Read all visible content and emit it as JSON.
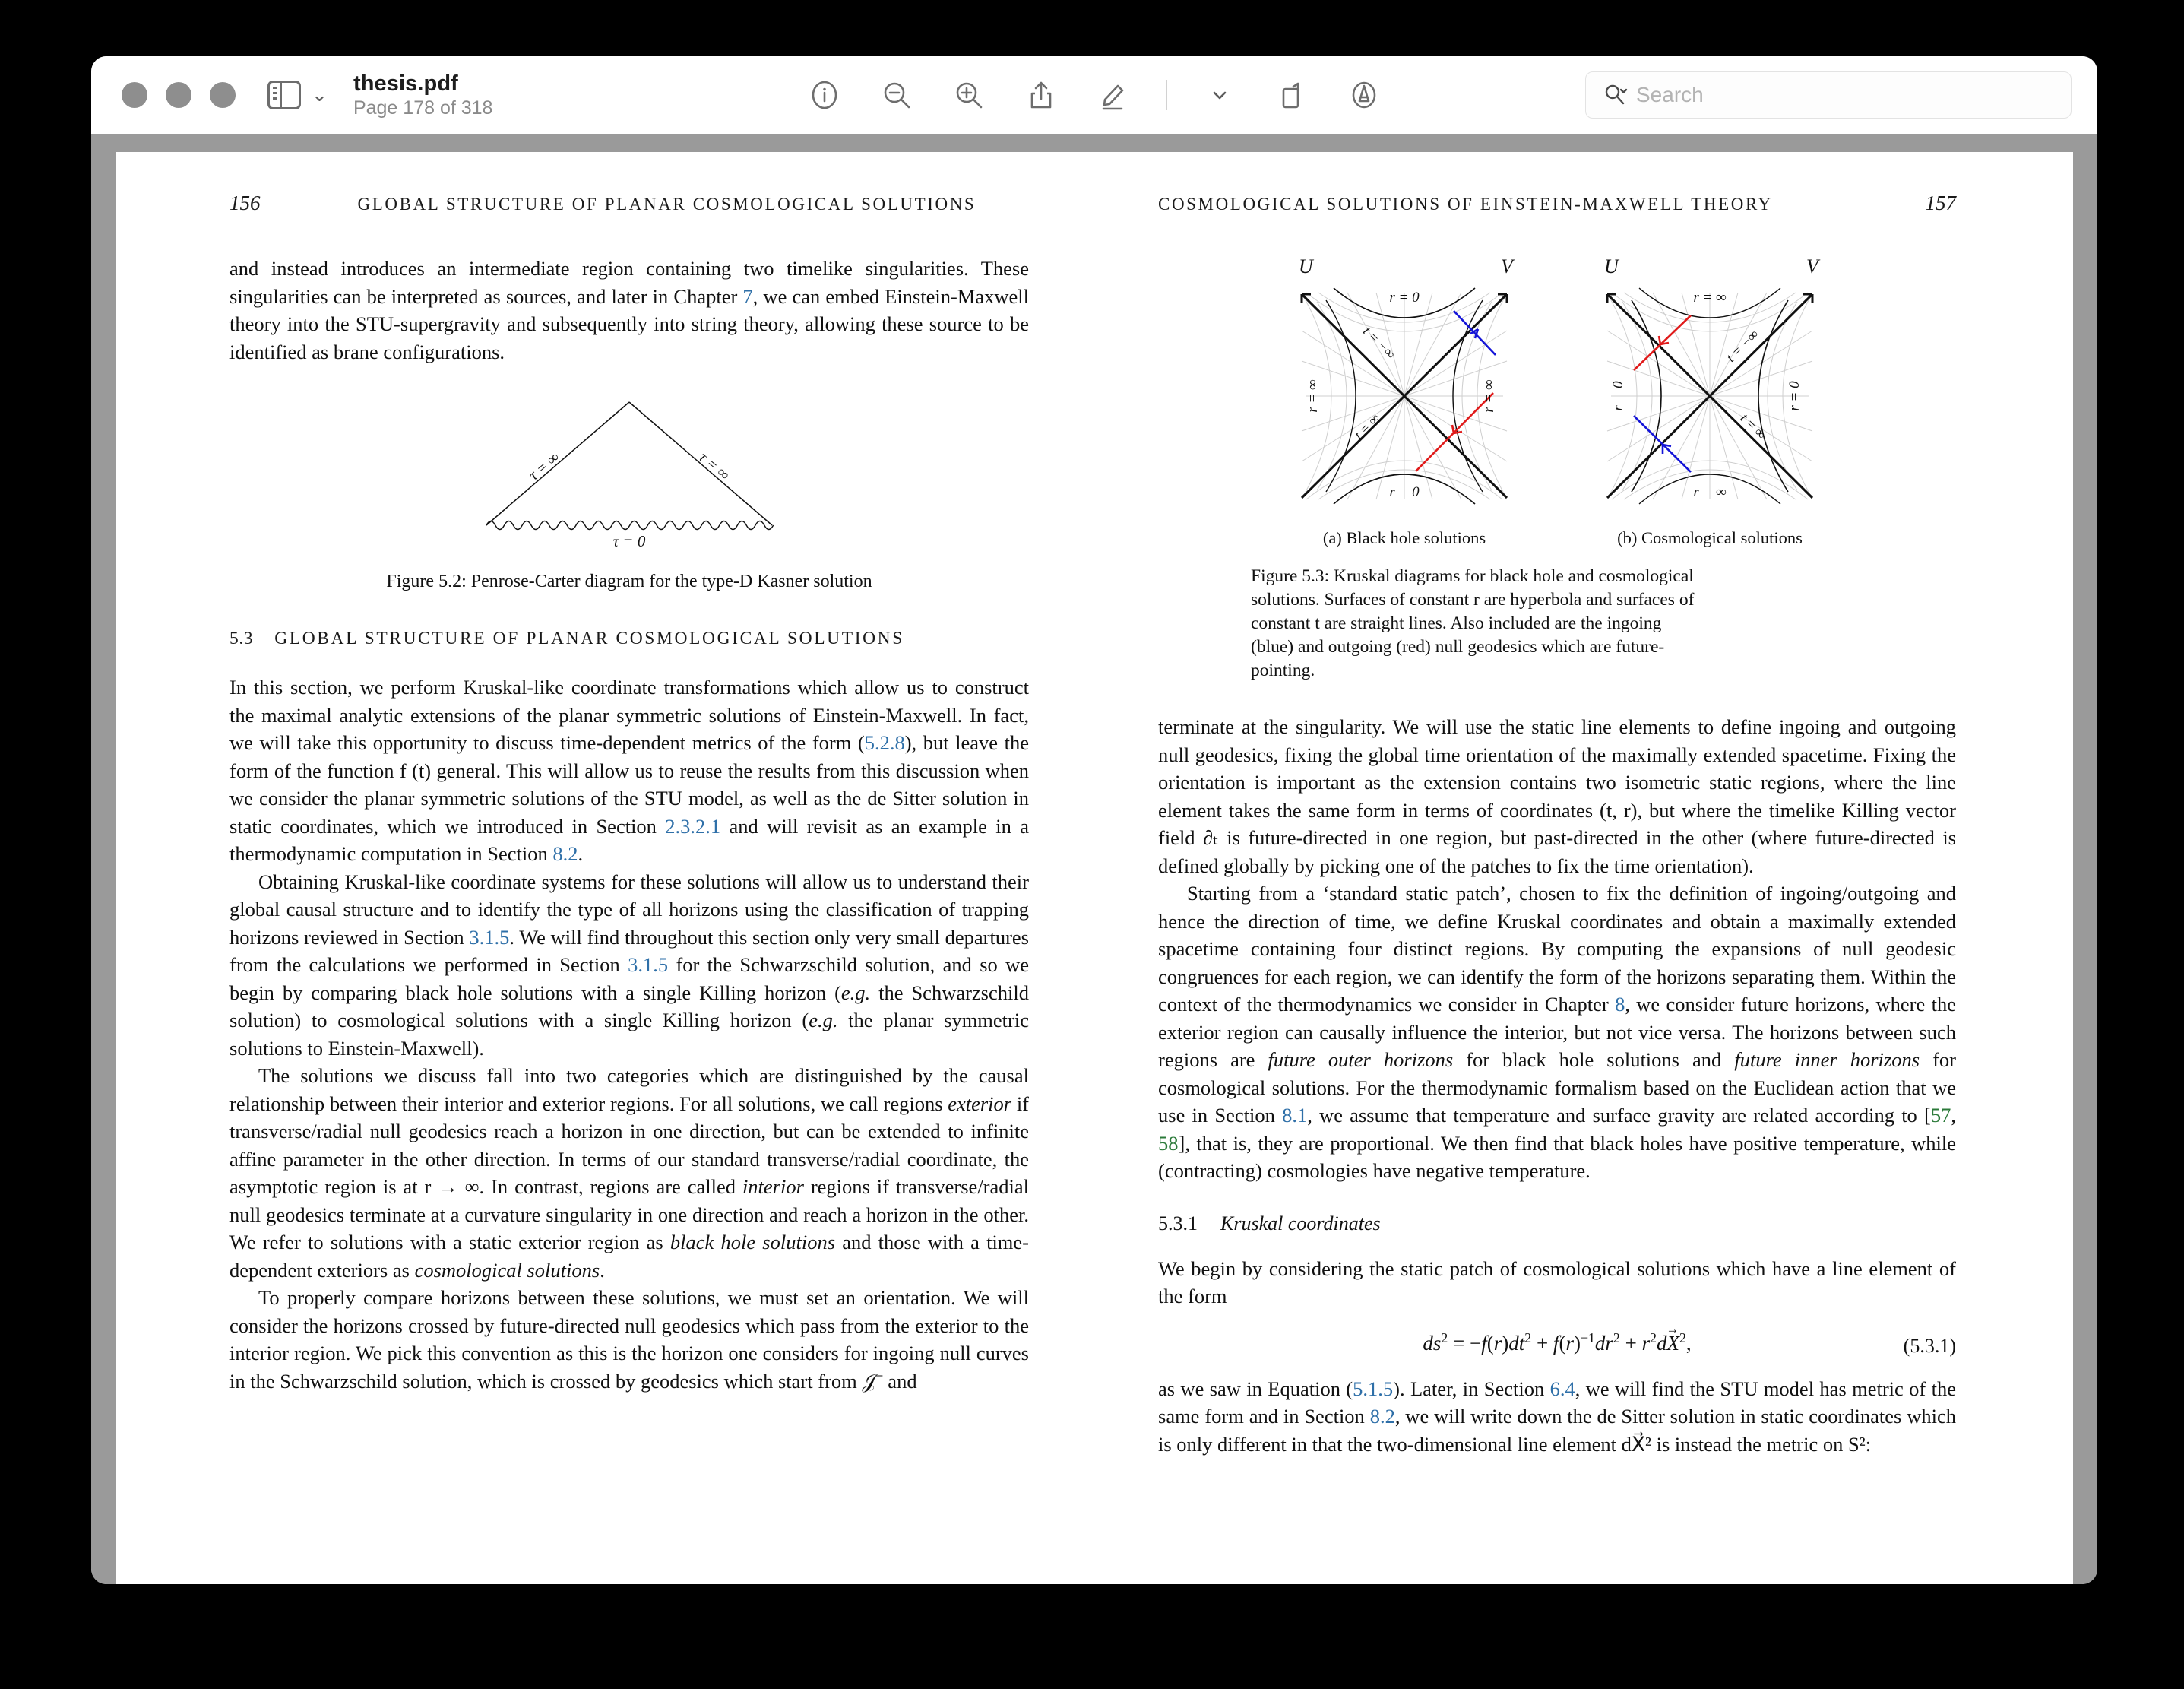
{
  "window": {
    "title": "thesis.pdf",
    "page_indicator": "Page 178 of 318",
    "traffic_lights": [
      "close-button",
      "minimize-button",
      "maximize-button"
    ]
  },
  "toolbar": {
    "sidebar_toggle": "sidebar-toggle-icon",
    "sidebar_chevron": "⌄",
    "buttons": [
      {
        "name": "info-button",
        "icon": "info-circle-icon"
      },
      {
        "name": "zoom-out-button",
        "icon": "magnifier-minus-icon"
      },
      {
        "name": "zoom-in-button",
        "icon": "magnifier-plus-icon"
      },
      {
        "name": "share-button",
        "icon": "share-arrow-up-icon"
      },
      {
        "name": "markup-button",
        "icon": "highlighter-pen-icon"
      },
      {
        "name": "markup-options-button",
        "icon": "chevron-down-icon"
      },
      {
        "name": "rotate-button",
        "icon": "rotate-page-icon"
      },
      {
        "name": "annotate-button",
        "icon": "circled-a-pen-icon"
      }
    ],
    "search": {
      "placeholder": "Search",
      "icon": "search-magnifier-chevron-icon",
      "value": ""
    }
  },
  "document": {
    "left_page": {
      "folio": "156",
      "running_head": "GLOBAL STRUCTURE OF PLANAR COSMOLOGICAL SOLUTIONS",
      "para_1_a": "and instead introduces an intermediate region containing two timelike singularities. These singularities can be interpreted as sources, and later in Chapter ",
      "para_1_ref": "7",
      "para_1_b": ", we can embed Einstein-Maxwell theory into the STU-supergravity and subsequently into string theory, allowing these source to be identified as brane configurations.",
      "figure_5_2": {
        "caption": "Figure 5.2: Penrose-Carter diagram for the type-D Kasner solution",
        "label_left": "τ = ∞",
        "label_right": "τ = ∞",
        "label_bottom": "τ = 0"
      },
      "section": {
        "number": "5.3",
        "title": "GLOBAL STRUCTURE OF PLANAR COSMOLOGICAL SOLUTIONS"
      },
      "para_2_a": "In this section, we perform Kruskal-like coordinate transformations which allow us to construct the maximal analytic extensions of the planar symmetric solutions of Einstein-Maxwell. In fact, we will take this opportunity to discuss time-dependent metrics of the form (",
      "para_2_ref1": "5.2.8",
      "para_2_b": "), but leave the form of the function f (t) general. This will allow us to reuse the results from this discussion when we consider the planar symmetric solutions of the STU model, as well as the de Sitter solution in static coordinates, which we introduced in Section ",
      "para_2_ref2": "2.3.2.1",
      "para_2_c": " and will revisit as an example in a thermodynamic computation in Section ",
      "para_2_ref3": "8.2",
      "para_2_d": ".",
      "para_3_a": "Obtaining Kruskal-like coordinate systems for these solutions will allow us to understand their global causal structure and to identify the type of all horizons using the classification of trapping horizons reviewed in Section ",
      "para_3_ref1": "3.1.5",
      "para_3_b": ". We will find throughout this section only very small departures from the calculations we performed in Section ",
      "para_3_ref2": "3.1.5",
      "para_3_c": " for the Schwarzschild solution, and so we begin by comparing black hole solutions with a single Killing horizon (",
      "para_3_em1": "e.g.",
      "para_3_d": " the Schwarzschild solution) to cosmological solutions with a single Killing horizon (",
      "para_3_em2": "e.g.",
      "para_3_e": " the planar symmetric solutions to Einstein-Maxwell).",
      "para_4_a": "The solutions we discuss fall into two categories which are distinguished by the causal relationship between their interior and exterior regions. For all solutions, we call regions ",
      "para_4_em1": "exterior",
      "para_4_b": " if transverse/radial null geodesics reach a horizon in one direction, but can be extended to infinite affine parameter in the other direction. In terms of our standard transverse/radial coordinate, the asymptotic region is at r → ∞. In contrast, regions are called ",
      "para_4_em2": "interior",
      "para_4_c": " regions if transverse/radial null geodesics terminate at a curvature singularity in one direction and reach a horizon in the other. We refer to solutions with a static exterior region as ",
      "para_4_em3": "black hole solutions",
      "para_4_d": " and those with a time-dependent exteriors as ",
      "para_4_em4": "cosmological solutions",
      "para_4_e": ".",
      "para_5": "To properly compare horizons between these solutions, we must set an orientation. We will consider the horizons crossed by future-directed null geodesics which pass from the exterior to the interior region. We pick this convention as this is the horizon one considers for ingoing null curves in the Schwarzschild solution, which is crossed by geodesics which start from 𝒥⁻ and"
    },
    "right_page": {
      "running_head": "COSMOLOGICAL SOLUTIONS OF EINSTEIN-MAXWELL THEORY",
      "folio": "157",
      "figure_5_3": {
        "axis_u": "U",
        "axis_v": "V",
        "panel_a": {
          "subcaption": "(a) Black hole solutions",
          "top": "r = 0",
          "bottom": "r = 0",
          "left": "r = ∞",
          "right": "r = ∞",
          "diag_upper": "t = −∞",
          "diag_lower": "t = ∞"
        },
        "panel_b": {
          "subcaption": "(b) Cosmological solutions",
          "top": "r = ∞",
          "bottom": "r = ∞",
          "left": "r = 0",
          "right": "r = 0",
          "diag_upper": "t = −∞",
          "diag_lower": "t = ∞"
        },
        "caption": "Figure 5.3: Kruskal diagrams for black hole and cosmological solutions. Surfaces of constant r are hyperbola and surfaces of constant t are straight lines. Also included are the ingoing (blue) and outgoing (red) null geodesics which are future-pointing.",
        "colors": {
          "ingoing": "#1414d8",
          "outgoing": "#e01a1a",
          "grid": "#cfcfcf",
          "axis": "#111111"
        }
      },
      "para_1": "terminate at the singularity. We will use the static line elements to define ingoing and outgoing null geodesics, fixing the global time orientation of the maximally extended spacetime. Fixing the orientation is important as the extension contains two isometric static regions, where the line element takes the same form in terms of coordinates (t, r), but where the timelike Killing vector field ∂ₜ is future-directed in one region, but past-directed in the other (where future-directed is defined globally by picking one of the patches to fix the time orientation).",
      "para_2_a": "Starting from a ‘standard static patch’, chosen to fix the definition of ingoing/outgoing and hence the direction of time, we define Kruskal coordinates and obtain a maximally extended spacetime containing four distinct regions. By computing the expansions of null geodesic congruences for each region, we can identify the form of the horizons separating them. Within the context of the thermodynamics we consider in Chapter ",
      "para_2_ref1": "8",
      "para_2_b": ", we consider future horizons, where the exterior region can causally influence the interior, but not vice versa. The horizons between such regions are ",
      "para_2_em1": "future outer horizons",
      "para_2_c": " for black hole solutions and ",
      "para_2_em2": "future inner horizons",
      "para_2_d": " for cosmological solutions. For the thermodynamic formalism based on the Euclidean action that we use in Section ",
      "para_2_ref2": "8.1",
      "para_2_e": ", we assume that temperature and surface gravity are related according to [",
      "para_2_cite1": "57",
      "para_2_f": ", ",
      "para_2_cite2": "58",
      "para_2_g": "], that is, they are proportional. We then find that black holes have positive temperature, while (contracting) cosmologies have negative temperature.",
      "subsection": {
        "number": "5.3.1",
        "title": "Kruskal coordinates"
      },
      "para_3": "We begin by considering the static patch of cosmological solutions which have a line element of the form",
      "equation": {
        "number": "(5.3.1)",
        "latex_text": "ds² = −f(r)dt² + f(r)⁻¹dr² + r²dX⃗²,"
      },
      "para_4_a": "as we saw in Equation (",
      "para_4_ref1": "5.1.5",
      "para_4_b": "). Later, in Section ",
      "para_4_ref2": "6.4",
      "para_4_c": ", we will find the STU model has metric of the same form and in Section ",
      "para_4_ref3": "8.2",
      "para_4_d": ", we will write down the de Sitter solution in static coordinates which is only different in that the two-dimensional line element dX⃗² is instead the metric on S²:"
    }
  }
}
